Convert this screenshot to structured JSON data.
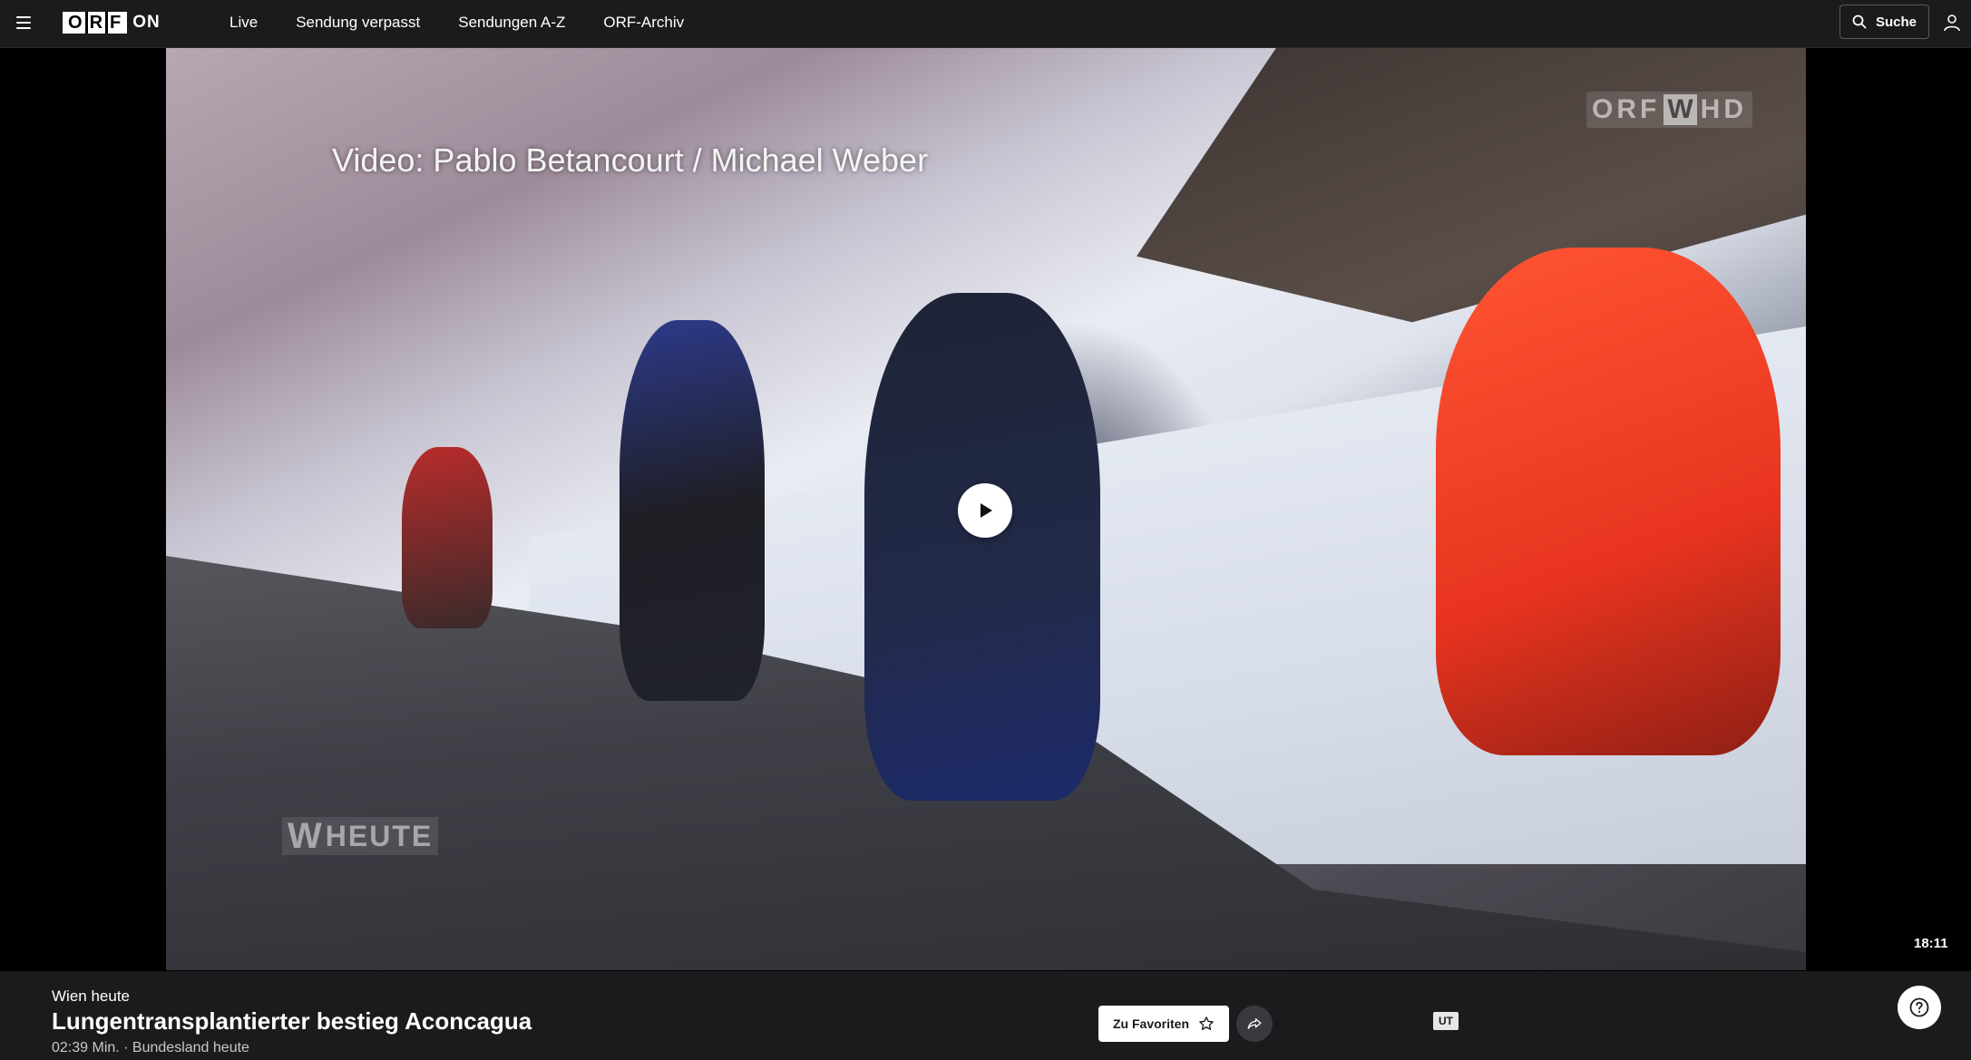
{
  "brand": {
    "logo_letters": [
      "O",
      "R",
      "F"
    ],
    "logo_suffix": "ON"
  },
  "nav": {
    "items": [
      {
        "label": "Live"
      },
      {
        "label": "Sendung verpasst"
      },
      {
        "label": "Sendungen A-Z"
      },
      {
        "label": "ORF-Archiv"
      }
    ],
    "search_label": "Suche"
  },
  "video": {
    "caption": "Video: Pablo Betancourt / Michael Weber",
    "channel_watermark": {
      "prefix": "ORF",
      "letter": "W",
      "suffix": "HD"
    },
    "show_watermark": {
      "letter": "W",
      "text": "HEUTE"
    },
    "total_duration": "18:11"
  },
  "info": {
    "show_name": "Wien heute",
    "title": "Lungentransplantierter bestieg Aconcagua",
    "meta": "02:39 Min. · Bundesland heute",
    "favorite_label": "Zu Favoriten",
    "subtitles_badge": "UT"
  },
  "colors": {
    "topbar_bg": "#1b1b1d",
    "page_bg": "#000000",
    "button_light": "#ffffff"
  },
  "icons": [
    "menu-icon",
    "search-icon",
    "user-icon",
    "play-icon",
    "star-icon",
    "share-icon",
    "help-icon"
  ]
}
